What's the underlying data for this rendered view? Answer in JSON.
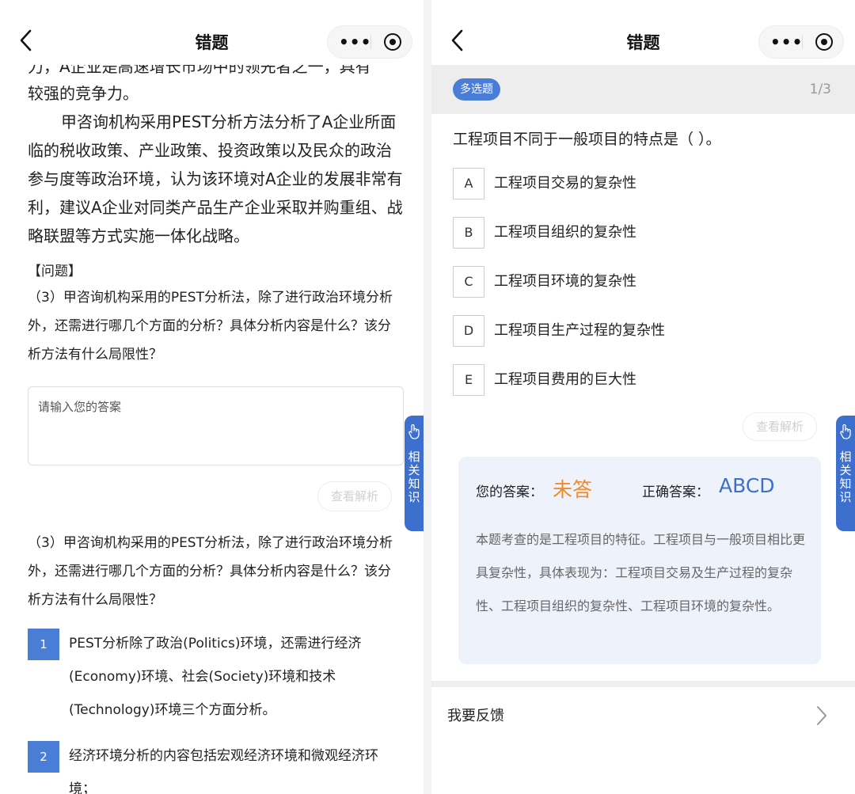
{
  "left": {
    "nav": {
      "title": "错题",
      "more": "•••"
    },
    "passage_cut": "力，A企业是高速增长市场中的领先者之一，具有",
    "passage_line2": "较强的竞争力。",
    "passage_para2": "甲咨询机构采用PEST分析方法分析了A企业所面临的税收政策、产业政策、投资政策以及民众的政治参与度等政治环境，认为该环境对A企业的发展非常有利，建议A企业对同类产品生产企业采取并购重组、战略联盟等方式实施一体化战略。",
    "question_heading": "【问题】",
    "question": "（3）甲咨询机构采用的PEST分析法，除了进行政治环境分析外，还需进行哪几个方面的分析？具体分析内容是什么？该分析方法有什么局限性？",
    "answer_placeholder": "请输入您的答案",
    "view_analysis": "查看解析",
    "question_repeat": "（3）甲咨询机构采用的PEST分析法，除了进行政治环境分析外，还需进行哪几个方面的分析？具体分析内容是什么？该分析方法有什么局限性？",
    "points": [
      {
        "num": "1",
        "text": "PEST分析除了政治(Politics)环境，还需进行经济(Economy)环境、社会(Society)环境和技术(Technology)环境三个方面分析。"
      },
      {
        "num": "2",
        "text": "经济环境分析的内容包括宏观经济环境和微观经济环境；"
      }
    ],
    "side_tab": "相关知识"
  },
  "right": {
    "nav": {
      "title": "错题",
      "more": "•••"
    },
    "question_type": "多选题",
    "progress": "1/3",
    "question": "工程项目不同于一般项目的特点是（   ）。",
    "options": [
      {
        "letter": "A",
        "text": "工程项目交易的复杂性"
      },
      {
        "letter": "B",
        "text": "工程项目组织的复杂性"
      },
      {
        "letter": "C",
        "text": "工程项目环境的复杂性"
      },
      {
        "letter": "D",
        "text": "工程项目生产过程的复杂性"
      },
      {
        "letter": "E",
        "text": "工程项目费用的巨大性"
      }
    ],
    "view_analysis": "查看解析",
    "your_answer_label": "您的答案：",
    "your_answer": "未答",
    "correct_answer_label": "正确答案：",
    "correct_answer": "ABCD",
    "explanation": "本题考查的是工程项目的特征。工程项目与一般项目相比更具复杂性，具体表现为：工程项目交易及生产过程的复杂性、工程项目组织的复杂性、工程项目环境的复杂性。",
    "feedback": "我要反馈",
    "side_tab": "相关知识"
  },
  "colors": {
    "accent": "#4a7dd6",
    "unanswered": "#f08a2a",
    "card_bg": "#eef3fb"
  }
}
